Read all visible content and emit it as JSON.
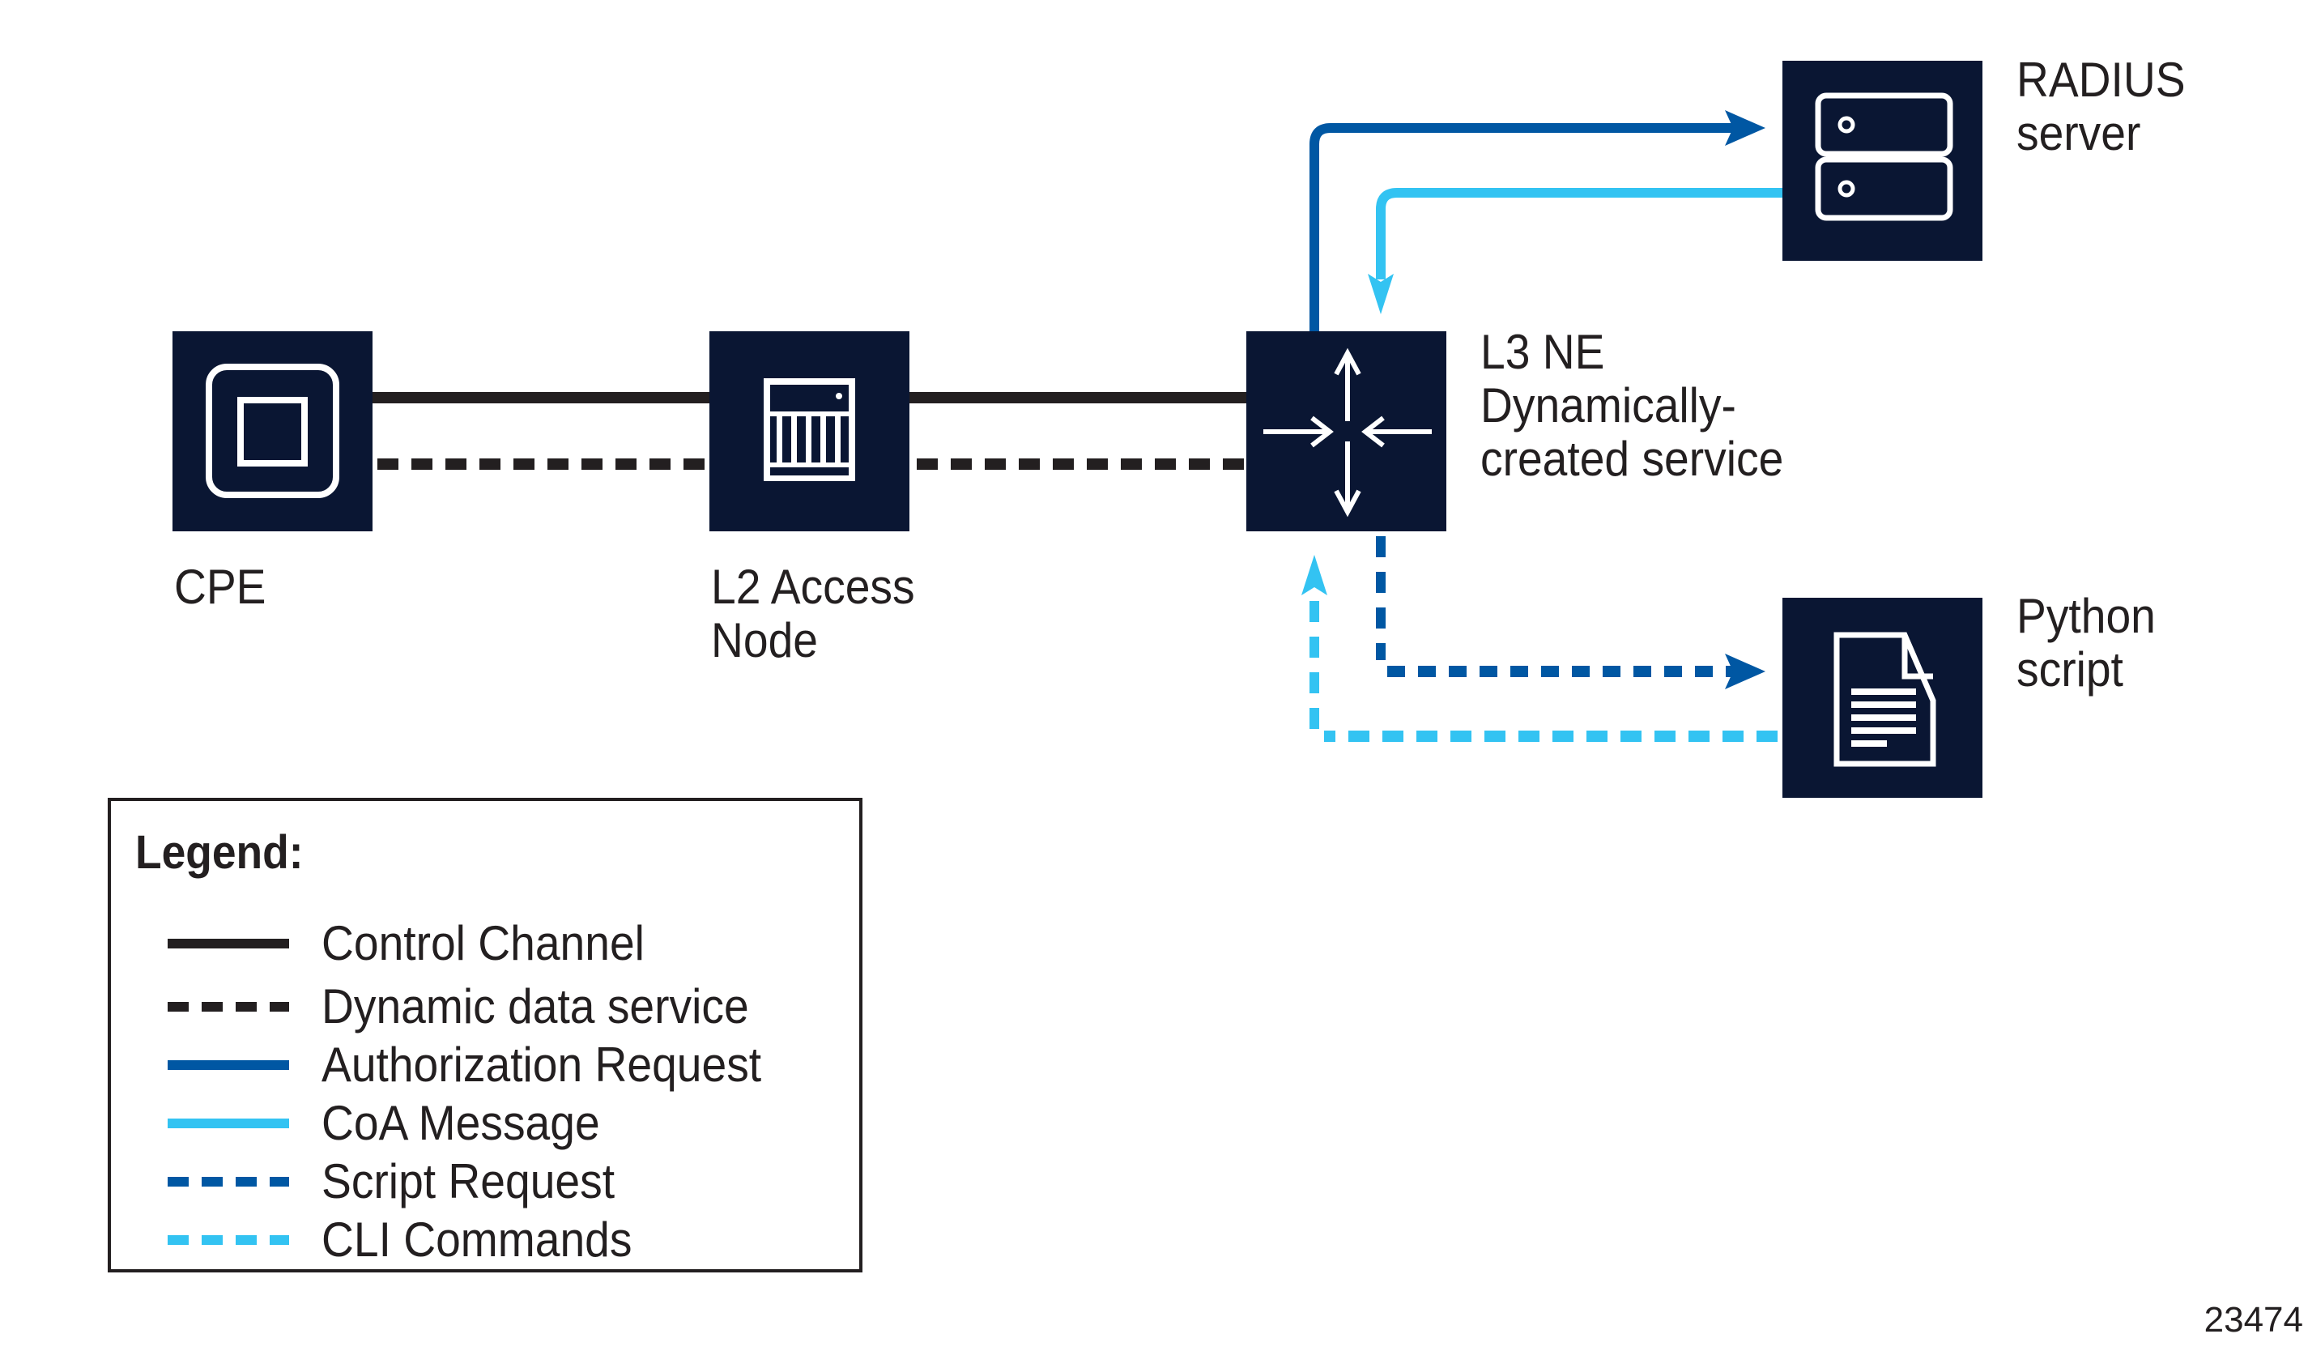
{
  "colors": {
    "node_fill": "#0a1633",
    "icon_stroke": "#ffffff",
    "control": "#231f20",
    "auth": "#0057a3",
    "coa": "#33c3f2",
    "script": "#0057a3",
    "cli": "#33c3f2"
  },
  "nodes": {
    "cpe": {
      "label": "CPE",
      "icon": "cpe-device-icon"
    },
    "l2": {
      "label_line1": "L2 Access",
      "label_line2": "Node",
      "icon": "access-node-icon"
    },
    "l3": {
      "label_line1": "L3 NE",
      "label_line2": "Dynamically-",
      "label_line3": "created service",
      "icon": "router-icon"
    },
    "radius": {
      "label_line1": "RADIUS",
      "label_line2": "server",
      "icon": "server-icon"
    },
    "python": {
      "label_line1": "Python",
      "label_line2": "script",
      "icon": "document-icon"
    }
  },
  "legend": {
    "title": "Legend:",
    "items": [
      {
        "label": "Control Channel",
        "style": "solid",
        "color": "#231f20"
      },
      {
        "label": "Dynamic data service",
        "style": "dashed",
        "color": "#231f20"
      },
      {
        "label": "Authorization Request",
        "style": "solid",
        "color": "#0057a3"
      },
      {
        "label": "CoA Message",
        "style": "solid",
        "color": "#33c3f2"
      },
      {
        "label": "Script Request",
        "style": "dashed",
        "color": "#0057a3"
      },
      {
        "label": "CLI Commands",
        "style": "dashed",
        "color": "#33c3f2"
      }
    ]
  },
  "figure_id": "23474"
}
